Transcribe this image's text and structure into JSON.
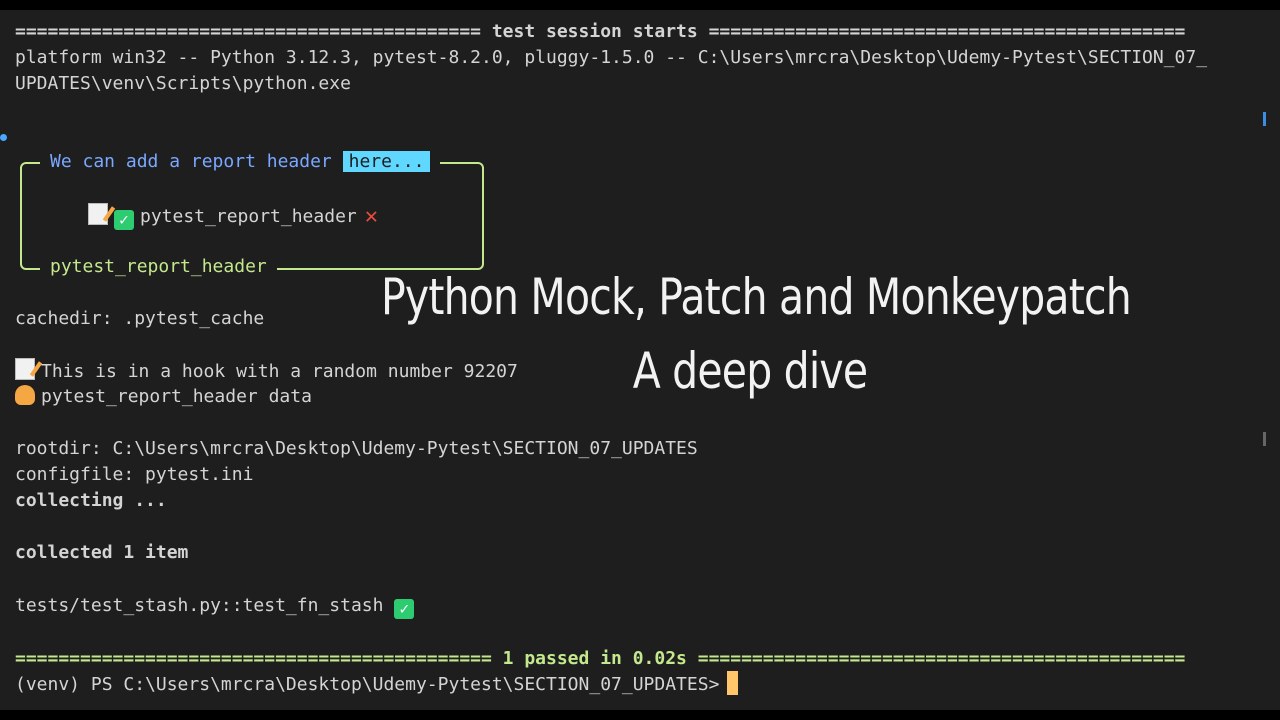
{
  "terminal": {
    "session_header": "=========================================== test session starts ============================================",
    "platform_line_1": "platform win32 -- Python 3.12.3, pytest-8.2.0, pluggy-1.5.0 -- C:\\Users\\mrcra\\Desktop\\Udemy-Pytest\\SECTION_07_",
    "platform_line_2": "UPDATES\\venv\\Scripts\\python.exe",
    "report_box": {
      "title": "We can add a report header",
      "highlight": "here...",
      "body": "pytest_report_header",
      "footer": "pytest_report_header"
    },
    "cachedir": "cachedir: .pytest_cache",
    "hook_line": "This is in a hook with a random number 92207",
    "hook_data": "pytest_report_header data",
    "rootdir": "rootdir: C:\\Users\\mrcra\\Desktop\\Udemy-Pytest\\SECTION_07_UPDATES",
    "configfile": "configfile: pytest.ini",
    "collecting": "collecting ...",
    "collected": "collected 1 item",
    "test_result": "tests/test_stash.py::test_fn_stash",
    "summary": "============================================ 1 passed in 0.02s =============================================",
    "prompt": "(venv) PS C:\\Users\\mrcra\\Desktop\\Udemy-Pytest\\SECTION_07_UPDATES>"
  },
  "overlay": {
    "title_line_1": "Python Mock, Patch and Monkeypatch",
    "title_line_2": "A deep dive"
  },
  "icons": {
    "memo": "memo-icon",
    "check": "check-mark-icon",
    "cross": "cross-mark-icon",
    "person": "person-raising-hand-icon"
  },
  "colors": {
    "background": "#1e1e1e",
    "text": "#d4d4d4",
    "box_border": "#c3e88d",
    "title_blue": "#7aa7ff",
    "highlight": "#5fd7ff",
    "check_green": "#2ecc71",
    "cross_red": "#e74c3c",
    "cursor": "#ffc56b"
  }
}
